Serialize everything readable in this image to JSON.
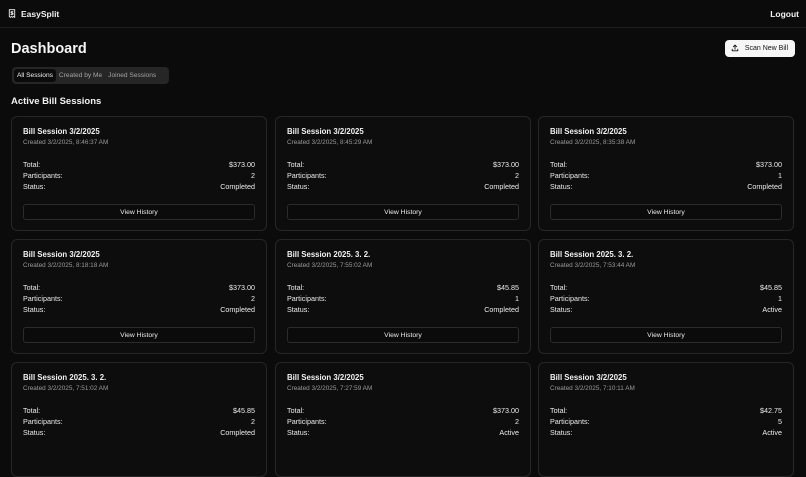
{
  "app": {
    "name": "EasySplit",
    "logout_label": "Logout"
  },
  "page": {
    "title": "Dashboard",
    "scan_button_label": "Scan New Bill",
    "tabs": [
      {
        "label": "All Sessions",
        "active": true
      },
      {
        "label": "Created by Me",
        "active": false
      },
      {
        "label": "Joined Sessions",
        "active": false
      }
    ],
    "section_title": "Active Bill Sessions"
  },
  "labels": {
    "total": "Total:",
    "participants": "Participants:",
    "status": "Status:",
    "view_history": "View History"
  },
  "sessions": [
    {
      "title": "Bill Session 3/2/2025",
      "created": "Created 3/2/2025, 8:46:37 AM",
      "total": "$373.00",
      "participants": "2",
      "status": "Completed"
    },
    {
      "title": "Bill Session 3/2/2025",
      "created": "Created 3/2/2025, 8:45:29 AM",
      "total": "$373.00",
      "participants": "2",
      "status": "Completed"
    },
    {
      "title": "Bill Session 3/2/2025",
      "created": "Created 3/2/2025, 8:35:38 AM",
      "total": "$373.00",
      "participants": "1",
      "status": "Completed"
    },
    {
      "title": "Bill Session 3/2/2025",
      "created": "Created 3/2/2025, 8:18:18 AM",
      "total": "$373.00",
      "participants": "2",
      "status": "Completed"
    },
    {
      "title": "Bill Session 2025. 3. 2.",
      "created": "Created 3/2/2025, 7:55:02 AM",
      "total": "$45.85",
      "participants": "1",
      "status": "Completed"
    },
    {
      "title": "Bill Session 2025. 3. 2.",
      "created": "Created 3/2/2025, 7:53:44 AM",
      "total": "$45.85",
      "participants": "1",
      "status": "Active"
    },
    {
      "title": "Bill Session 2025. 3. 2.",
      "created": "Created 3/2/2025, 7:51:02 AM",
      "total": "$45.85",
      "participants": "2",
      "status": "Completed"
    },
    {
      "title": "Bill Session 3/2/2025",
      "created": "Created 3/2/2025, 7:27:59 AM",
      "total": "$373.00",
      "participants": "2",
      "status": "Active"
    },
    {
      "title": "Bill Session 3/2/2025",
      "created": "Created 3/2/2025, 7:10:11 AM",
      "total": "$42.75",
      "participants": "5",
      "status": "Active"
    }
  ]
}
